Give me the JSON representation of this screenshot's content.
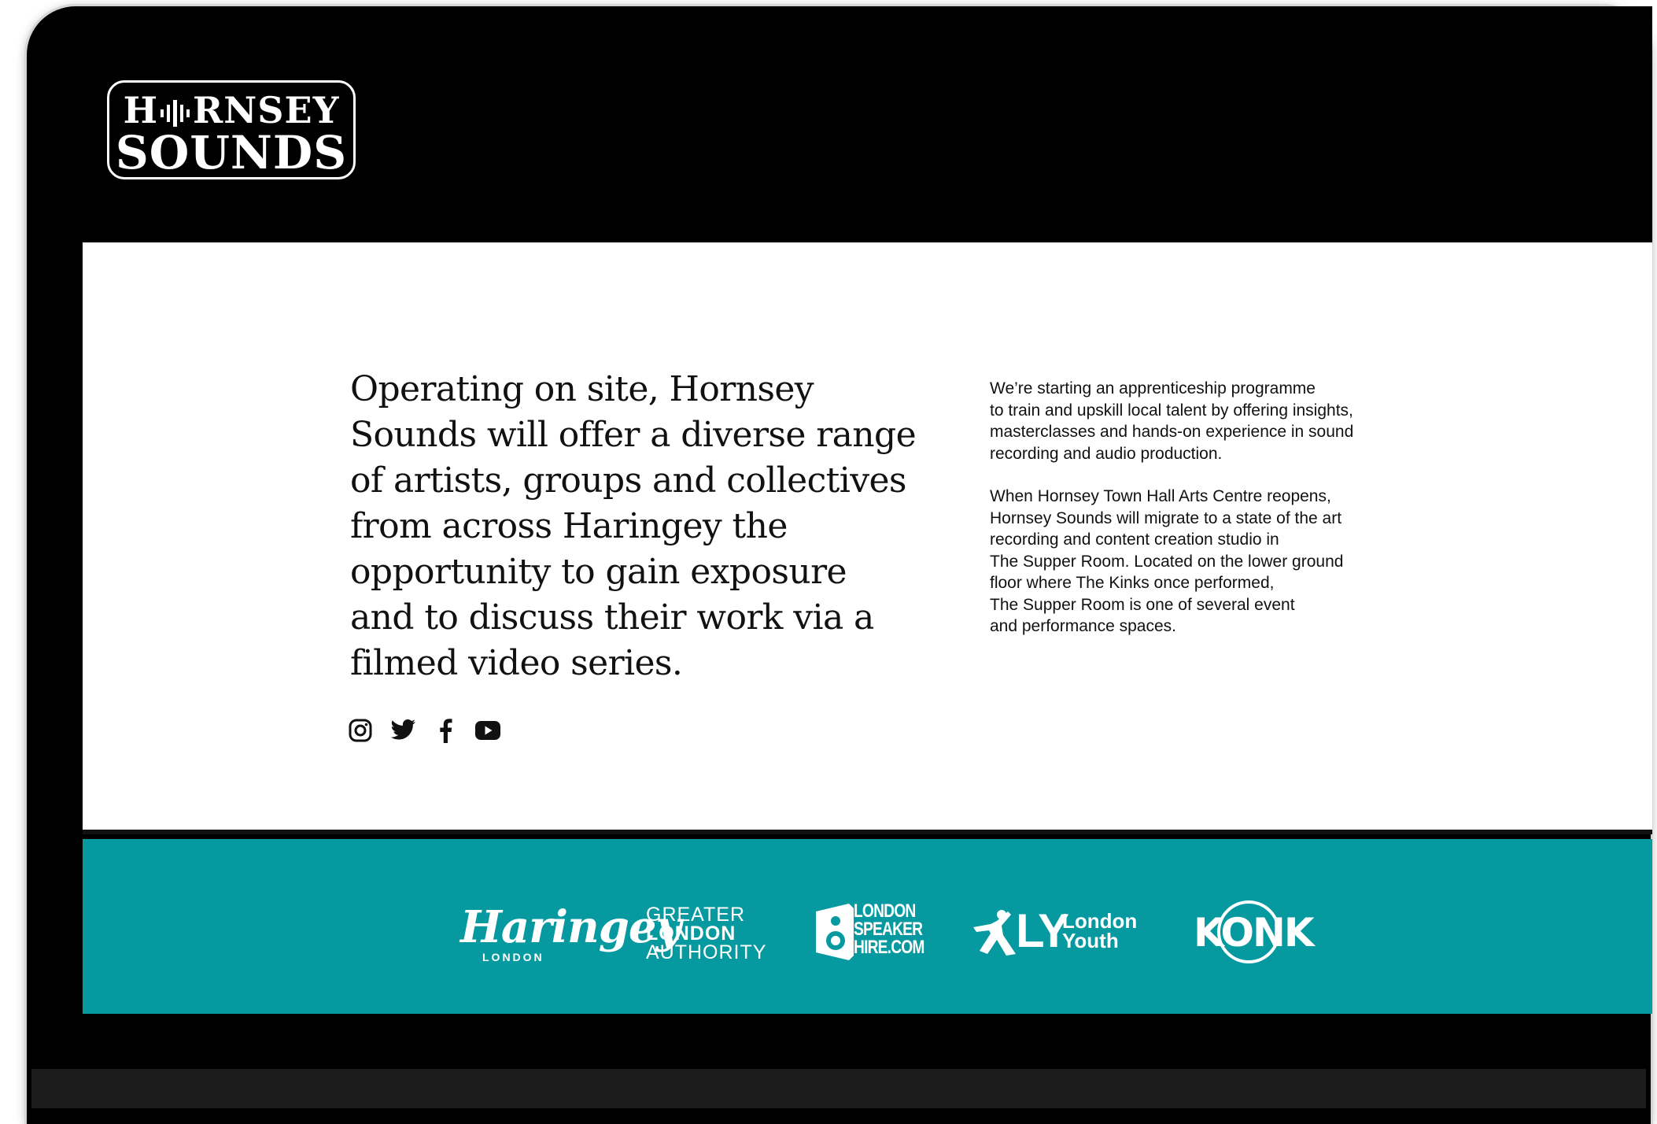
{
  "colors": {
    "frame": "#000000",
    "content_bg": "#ffffff",
    "partners_bg": "#069aa0",
    "text": "#111111"
  },
  "header": {
    "logo": {
      "line1": "H  RNSEY",
      "line2": "SOUNDS"
    }
  },
  "main": {
    "lead": "Operating on site, Hornsey Sounds will offer a diverse range of artists, groups and collectives from across Haringey the opportunity to gain exposure and to discuss their work via a filmed video series.",
    "paragraphs": [
      "We’re starting an apprenticeship programme\nto train and upskill local talent by offering insights,\nmasterclasses and hands-on experience in sound\nrecording and audio production.",
      "When Hornsey Town Hall Arts Centre reopens,\nHornsey Sounds will migrate to a state of the art\nrecording and content creation studio in\nThe Supper Room. Located on the lower ground\nfloor where The Kinks once performed,\nThe Supper Room is one of several event\nand performance spaces."
    ],
    "social_icons": [
      "instagram-icon",
      "twitter-icon",
      "facebook-icon",
      "youtube-icon"
    ]
  },
  "partners": {
    "haringey": {
      "main": "Haringey",
      "sub": "LONDON"
    },
    "gla": {
      "line1": "GREATER",
      "line2": "LONDON",
      "line3": "AUTHORITY"
    },
    "london_speaker_hire": {
      "line1": "LONDON",
      "line2": "SPEAKER",
      "line3": "HIRE.COM"
    },
    "london_youth": {
      "mark": "LY",
      "line1": "London",
      "line2": "Youth"
    },
    "konk": {
      "word": "KONK"
    }
  }
}
